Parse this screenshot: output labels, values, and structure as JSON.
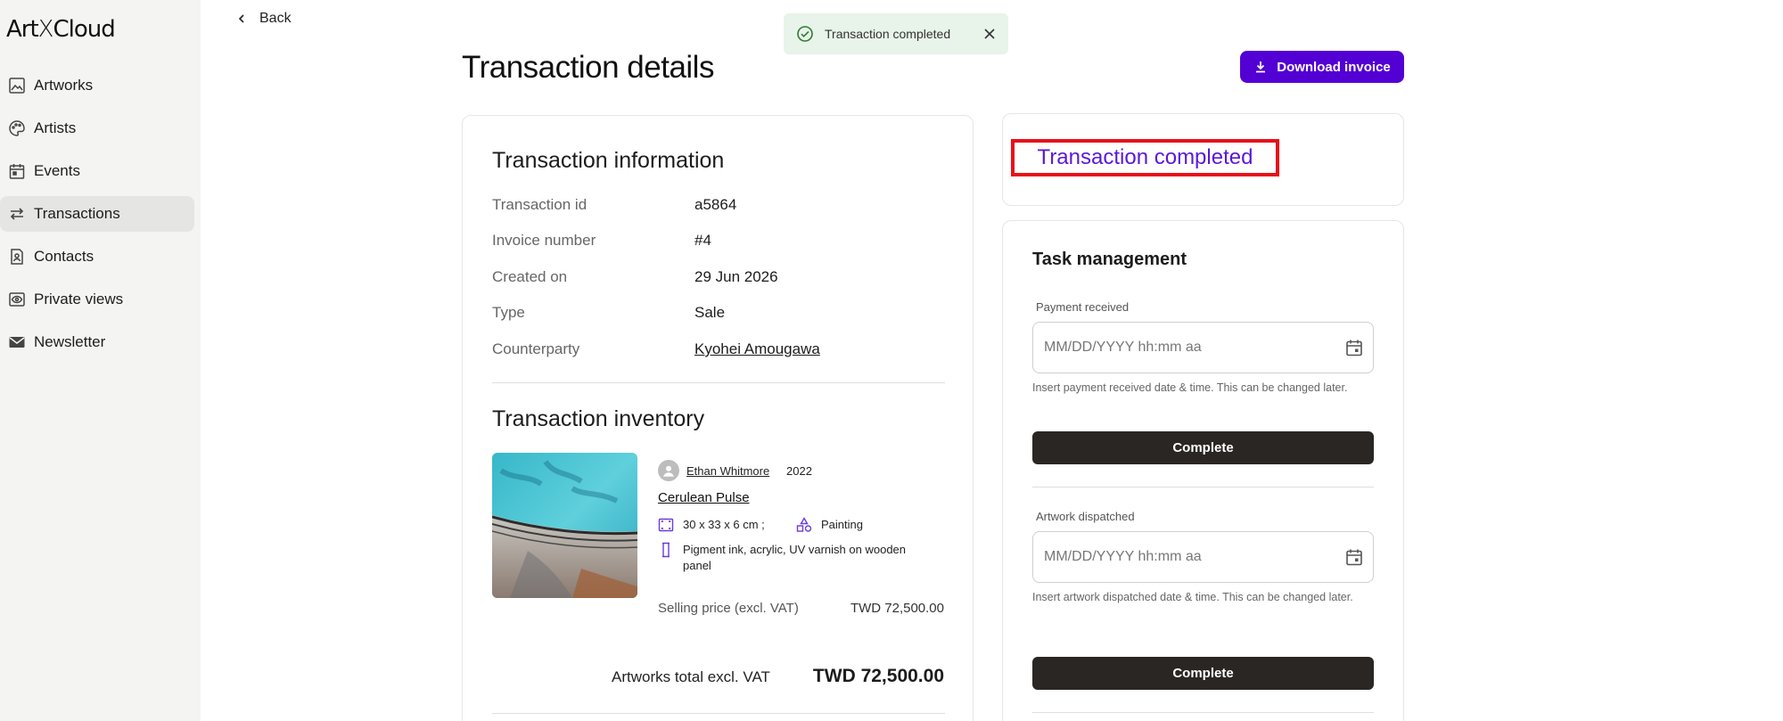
{
  "brand": {
    "logo_left": "Art",
    "logo_x": "X",
    "logo_right": "Cloud"
  },
  "sidebar": {
    "items": [
      {
        "label": "Artworks",
        "icon": "image-icon",
        "active": false
      },
      {
        "label": "Artists",
        "icon": "palette-icon",
        "active": false
      },
      {
        "label": "Events",
        "icon": "calendar-icon",
        "active": false
      },
      {
        "label": "Transactions",
        "icon": "swap-arrows-icon",
        "active": true
      },
      {
        "label": "Contacts",
        "icon": "contact-card-icon",
        "active": false
      },
      {
        "label": "Private views",
        "icon": "eye-icon",
        "active": false
      },
      {
        "label": "Newsletter",
        "icon": "mail-icon",
        "active": false
      }
    ]
  },
  "header": {
    "back_label": "Back",
    "title": "Transaction details",
    "download_label": "Download invoice"
  },
  "toast": {
    "message": "Transaction completed"
  },
  "transaction_info": {
    "title": "Transaction information",
    "rows": [
      {
        "label": "Transaction id",
        "value": "a5864"
      },
      {
        "label": "Invoice number",
        "value": "#4"
      },
      {
        "label": "Created on",
        "value": "29 Jun 2026"
      },
      {
        "label": "Type",
        "value": "Sale"
      },
      {
        "label": "Counterparty",
        "value": "Kyohei Amougawa"
      }
    ]
  },
  "inventory": {
    "title": "Transaction inventory",
    "artist": "Ethan Whitmore",
    "year": "2022",
    "artwork_title": "Cerulean Pulse",
    "dimensions": "30 x 33 x 6 cm ;",
    "medium_type": "Painting",
    "materials_line1": "Pigment ink, acrylic, UV varnish on wooden",
    "materials_line2": "panel",
    "price_label": "Selling price (excl. VAT)",
    "price_value": "TWD  72,500.00",
    "total_label": "Artworks total excl. VAT",
    "total_value": "TWD 72,500.00"
  },
  "status": {
    "text": "Transaction completed"
  },
  "task_management": {
    "title": "Task management",
    "payment": {
      "label": "Payment received",
      "placeholder": "MM/DD/YYYY hh:mm aa",
      "hint": "Insert payment received date & time. This can be changed later.",
      "button": "Complete"
    },
    "dispatch": {
      "label": "Artwork dispatched",
      "placeholder": "MM/DD/YYYY hh:mm aa",
      "hint": "Insert artwork dispatched date & time. This can be changed later.",
      "button": "Complete"
    }
  },
  "colors": {
    "accent": "#5200d4",
    "status_text": "#5a18d8",
    "highlight_border": "#e8101a",
    "toast_bg": "#e8f3ea",
    "sidebar_bg": "#f4f4f3",
    "button_dark": "#2a2624"
  }
}
